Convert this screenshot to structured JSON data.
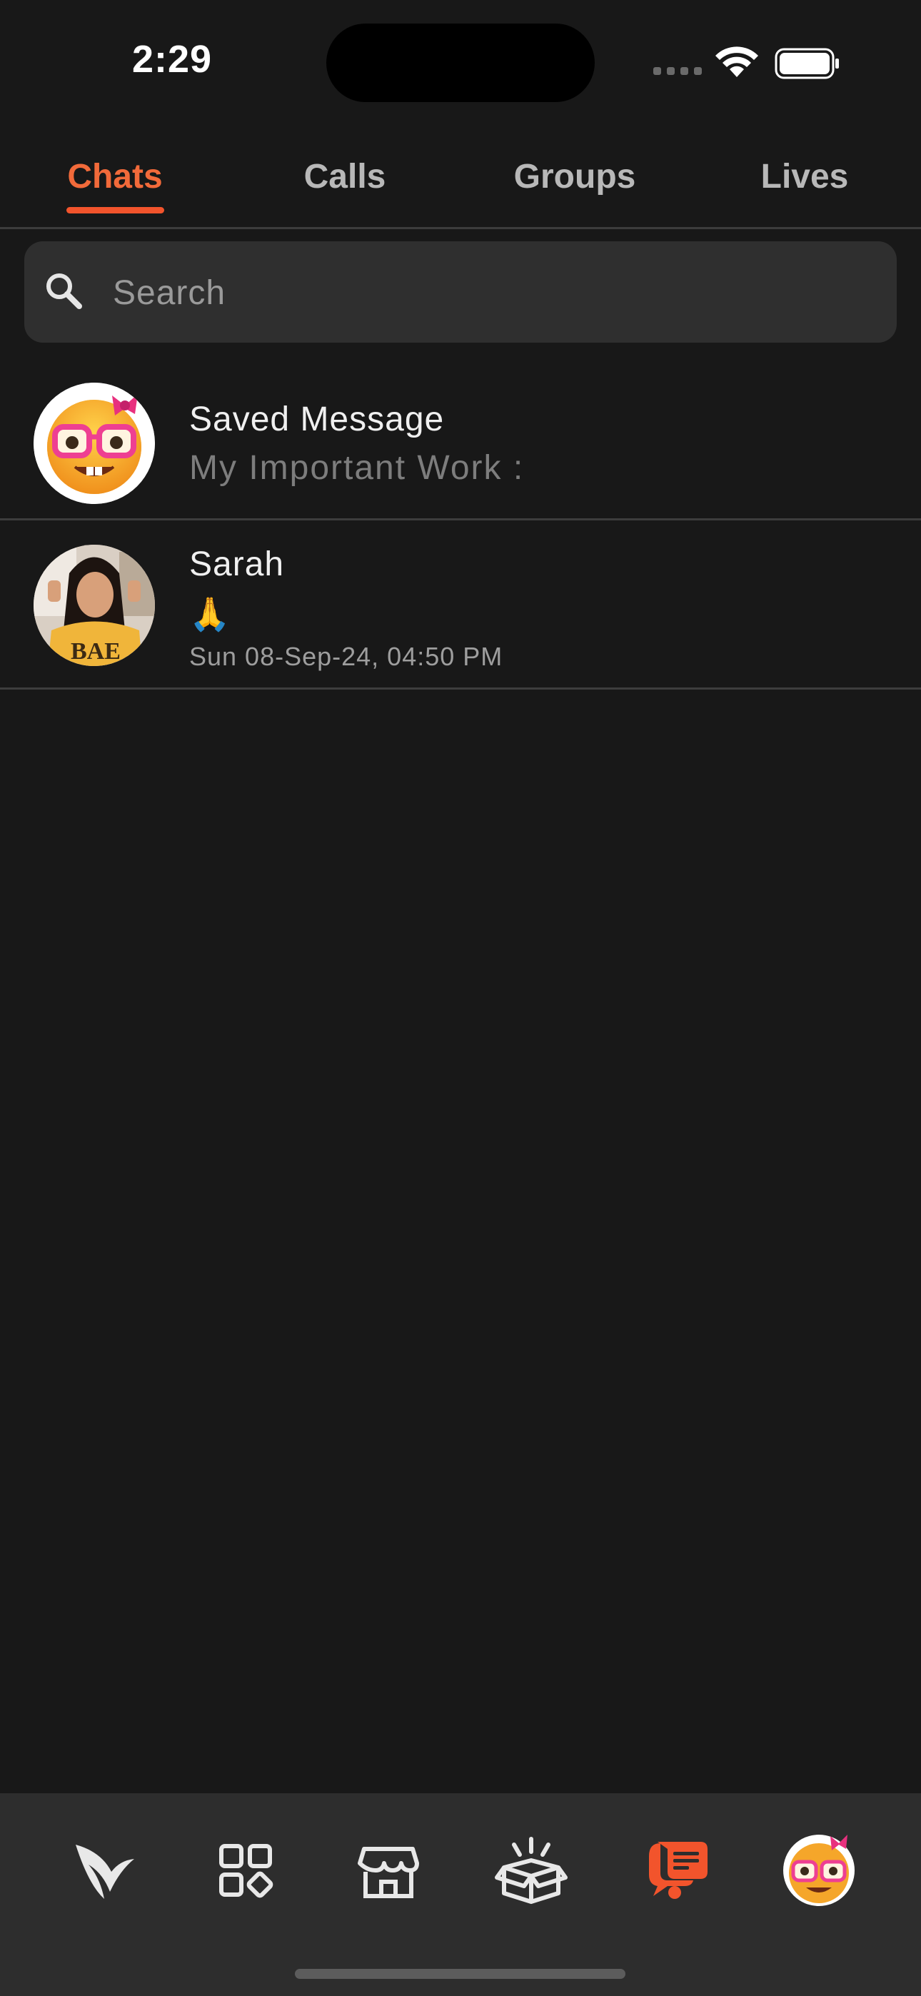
{
  "status_bar": {
    "time": "2:29"
  },
  "tabs": [
    {
      "label": "Chats",
      "active": true
    },
    {
      "label": "Calls",
      "active": false
    },
    {
      "label": "Groups",
      "active": false
    },
    {
      "label": "Lives",
      "active": false
    }
  ],
  "search": {
    "placeholder": "Search",
    "value": ""
  },
  "chats": [
    {
      "name": "Saved Message",
      "preview": "My Important Work :",
      "avatar_icon": "nerd-face-with-bow-icon"
    },
    {
      "name": "Sarah",
      "preview": "🙏",
      "time": "Sun 08-Sep-24, 04:50 PM",
      "avatar_icon": "profile-photo"
    }
  ],
  "bottom_nav": {
    "items": [
      {
        "icon": "brand-bird-icon",
        "active": false
      },
      {
        "icon": "apps-grid-icon",
        "active": false
      },
      {
        "icon": "store-icon",
        "active": false
      },
      {
        "icon": "gift-box-icon",
        "active": false
      },
      {
        "icon": "chat-bubble-icon",
        "active": true
      },
      {
        "icon": "profile-avatar-icon",
        "active": false
      }
    ]
  },
  "colors": {
    "accent": "#f2542c",
    "background": "#181818",
    "surface": "#2f2f2f"
  }
}
